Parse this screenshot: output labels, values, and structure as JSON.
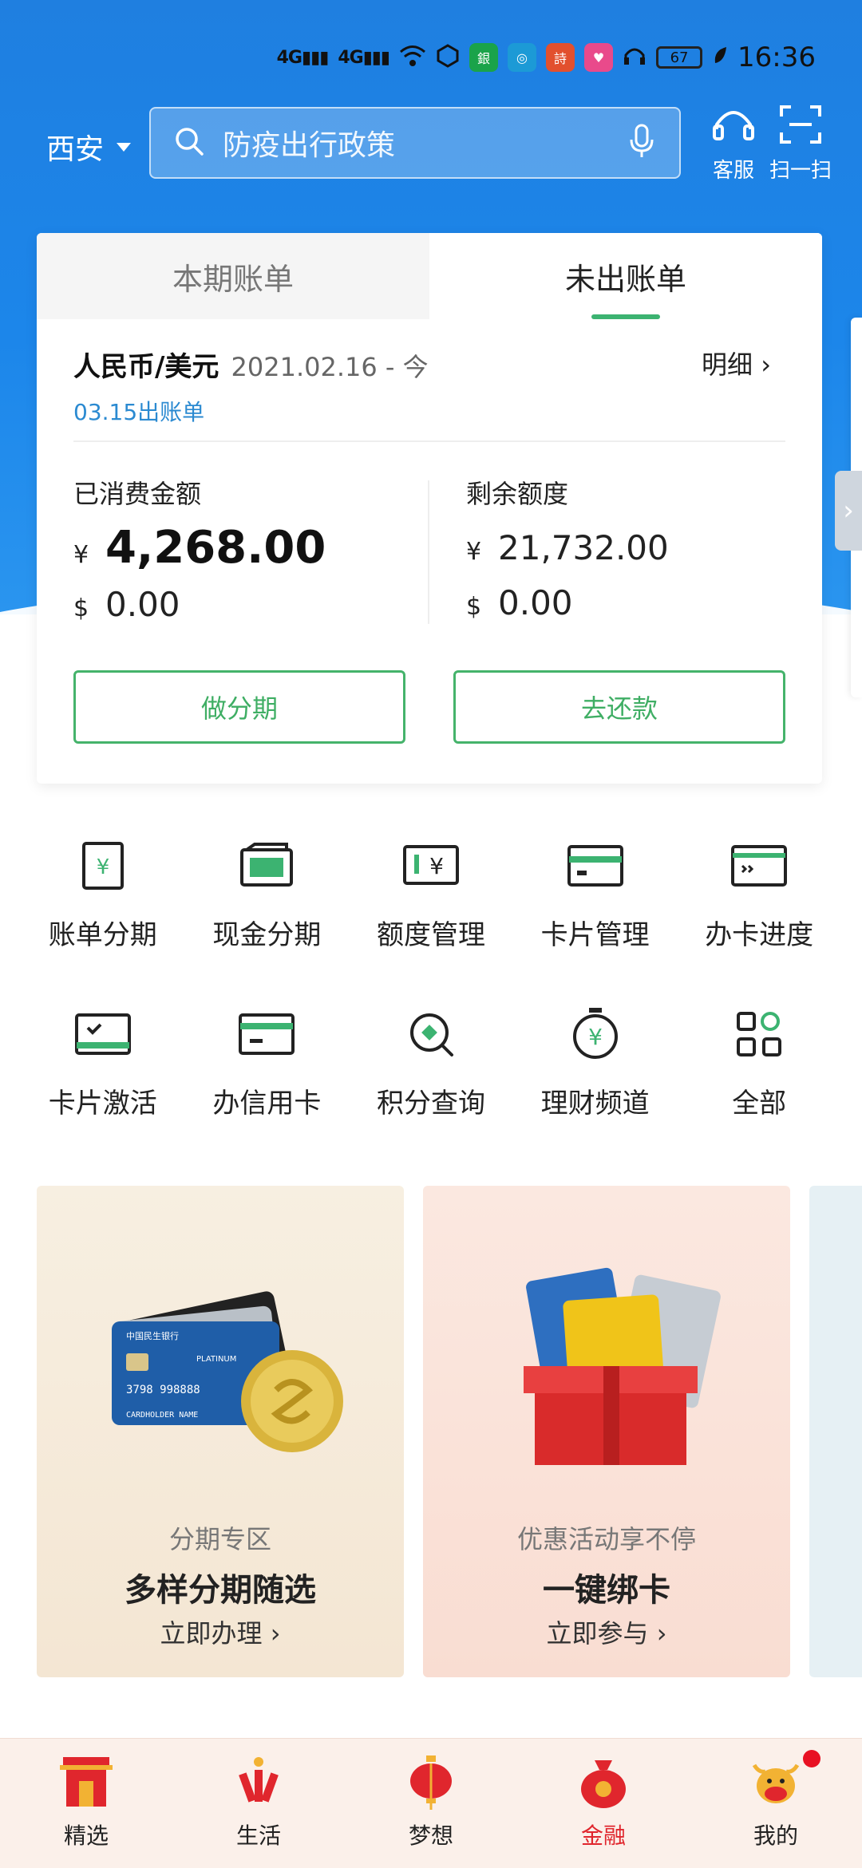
{
  "status_bar": {
    "signal1": "4G",
    "signal2": "4G",
    "battery": "67",
    "time": "16:36"
  },
  "header": {
    "city": "西安",
    "search_placeholder": "防疫出行政策",
    "service_label": "客服",
    "scan_label": "扫一扫"
  },
  "bill": {
    "tabs": [
      "本期账单",
      "未出账单"
    ],
    "active_tab": 1,
    "currency": "人民币/美元",
    "period": "2021.02.16 - 今",
    "statement_date": "03.15出账单",
    "detail_label": "明细",
    "spent_label": "已消费金额",
    "spent_cny_symbol": "¥",
    "spent_cny": "4,268.00",
    "spent_usd_symbol": "$",
    "spent_usd": "0.00",
    "remaining_label": "剩余额度",
    "remaining_cny_symbol": "¥",
    "remaining_cny": "21,732.00",
    "remaining_usd_symbol": "$",
    "remaining_usd": "0.00",
    "installment_button": "做分期",
    "repay_button": "去还款"
  },
  "services": [
    {
      "label": "账单分期",
      "icon": "bill-installment-icon"
    },
    {
      "label": "现金分期",
      "icon": "cash-installment-icon"
    },
    {
      "label": "额度管理",
      "icon": "limit-management-icon"
    },
    {
      "label": "卡片管理",
      "icon": "card-management-icon"
    },
    {
      "label": "办卡进度",
      "icon": "application-progress-icon"
    },
    {
      "label": "卡片激活",
      "icon": "card-activation-icon"
    },
    {
      "label": "办信用卡",
      "icon": "apply-credit-card-icon"
    },
    {
      "label": "积分查询",
      "icon": "points-query-icon"
    },
    {
      "label": "理财频道",
      "icon": "wealth-channel-icon"
    },
    {
      "label": "全部",
      "icon": "all-services-icon"
    }
  ],
  "promos": [
    {
      "subtitle": "分期专区",
      "title": "多样分期随选",
      "cta": "立即办理"
    },
    {
      "subtitle": "优惠活动享不停",
      "title": "一键绑卡",
      "cta": "立即参与"
    }
  ],
  "promo_card_text": {
    "bank": "中国民生银行",
    "card_number": "3798 998888",
    "holder": "CARDHOLDER NAME",
    "tier": "PLATINUM"
  },
  "bottom_nav": [
    {
      "label": "精选",
      "icon": "gate-icon"
    },
    {
      "label": "生活",
      "icon": "firecracker-icon"
    },
    {
      "label": "梦想",
      "icon": "lantern-icon"
    },
    {
      "label": "金融",
      "icon": "money-bag-icon"
    },
    {
      "label": "我的",
      "icon": "ox-icon"
    }
  ],
  "colors": {
    "brand_blue": "#1f7fe0",
    "accent_green": "#45b36b",
    "active_red": "#e0262d"
  }
}
